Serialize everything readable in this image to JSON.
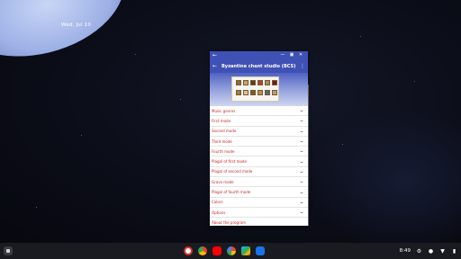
{
  "desktop": {
    "date": "Wed, Jul 10"
  },
  "window": {
    "app_title": "Byzantine chant studio (BCS)",
    "titlebar": {
      "back_icon": "arrow-left-icon",
      "buttons": [
        "minimize-icon",
        "maximize-icon",
        "close-icon"
      ]
    },
    "menu": [
      "Music genres",
      "First mode",
      "Second mode",
      "Third mode",
      "Fourth mode",
      "Plagal of first mode",
      "Plagal of second mode",
      "Grave mode",
      "Plagal of fourth mode",
      "Colors",
      "Options",
      "About the program"
    ],
    "accent_color": "#3f51b5",
    "item_text_color": "#c62828"
  },
  "shelf": {
    "apps": [
      "gmail-icon",
      "chrome-icon",
      "youtube-icon",
      "photos-icon",
      "play-store-icon",
      "files-icon"
    ],
    "time": "8:49"
  }
}
